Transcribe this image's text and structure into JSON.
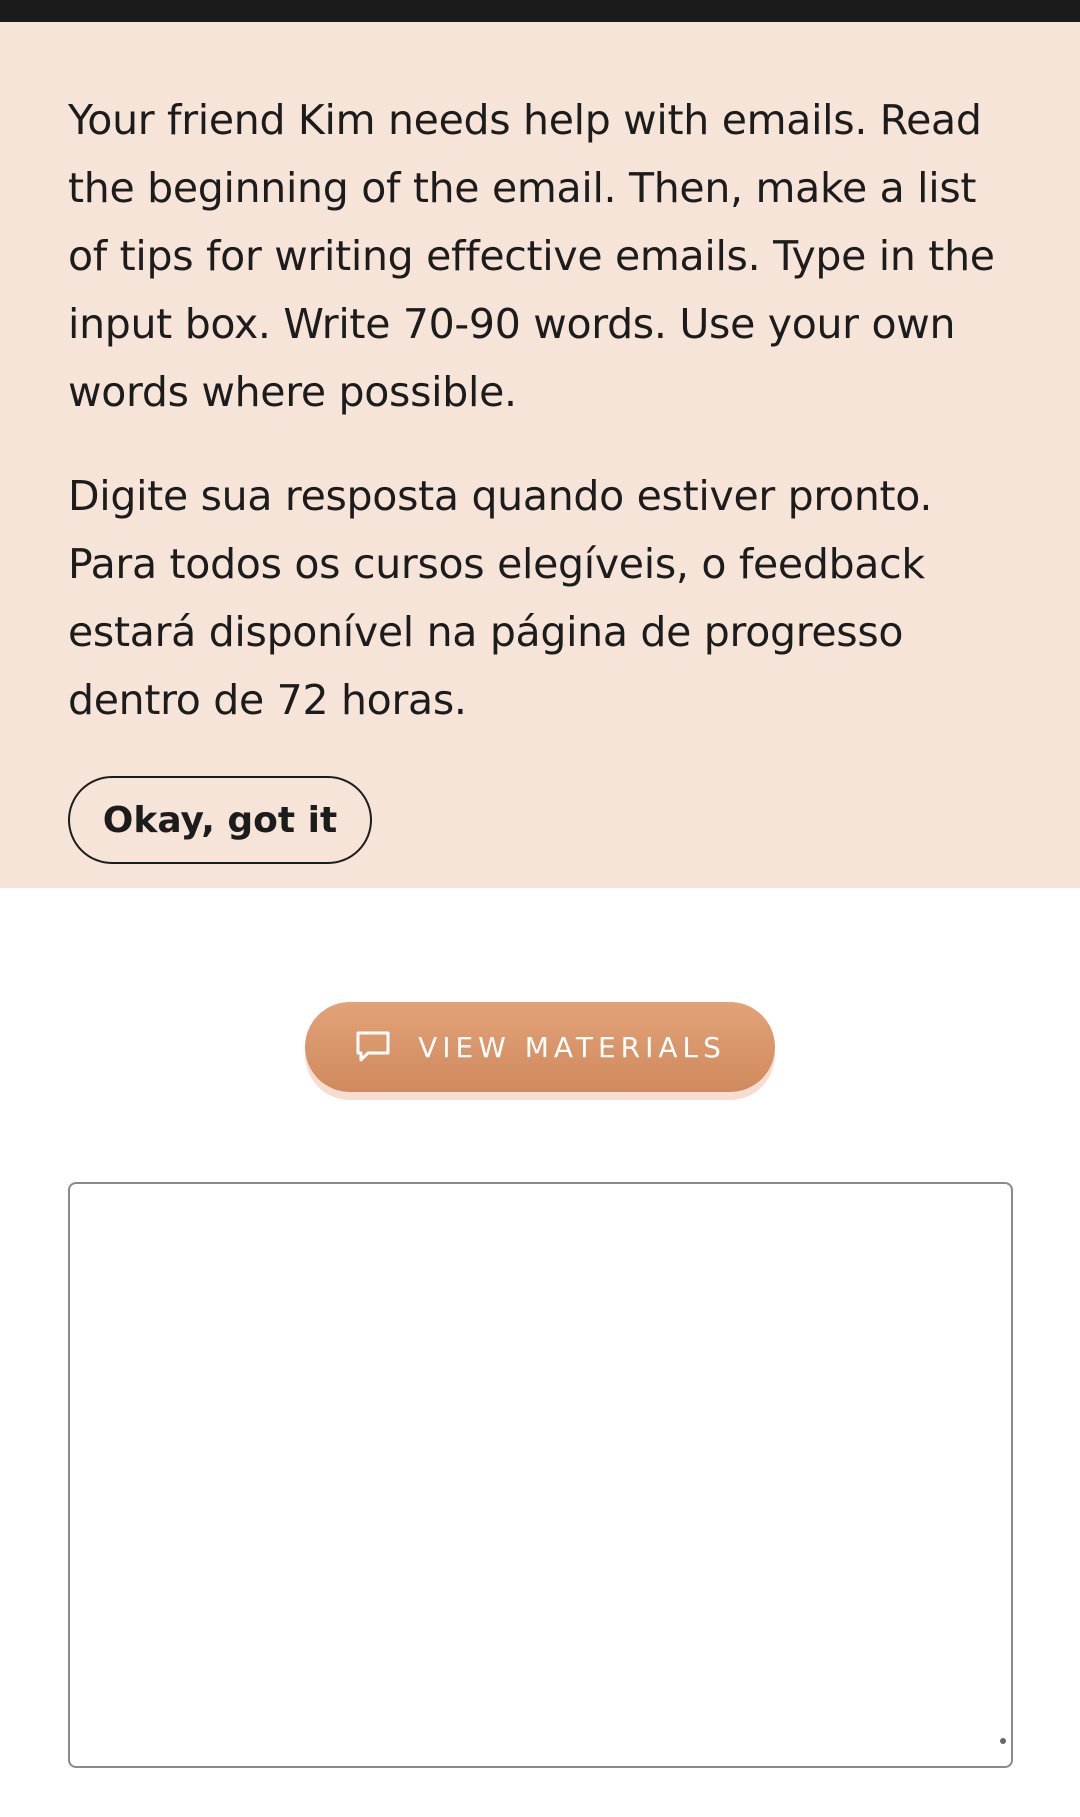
{
  "instructions": {
    "paragraph_en": "Your friend Kim needs help with emails. Read the beginning of the email. Then, make a list of tips for writing effective emails. Type in the input box. Write 70-90 words. Use your own words where possible.",
    "paragraph_pt": "Digite sua resposta quando estiver pronto. Para todos os cursos elegíveis, o feedback estará disponível na página de progresso dentro de 72 horas.",
    "dismiss_label": "Okay, got it"
  },
  "materials": {
    "label": "VIEW MATERIALS",
    "icon": "chat-bubble-icon"
  },
  "response": {
    "value": "",
    "placeholder": ""
  },
  "colors": {
    "panel_bg": "#f6e4d8",
    "accent": "#d9946a",
    "text": "#1c1c1c"
  }
}
